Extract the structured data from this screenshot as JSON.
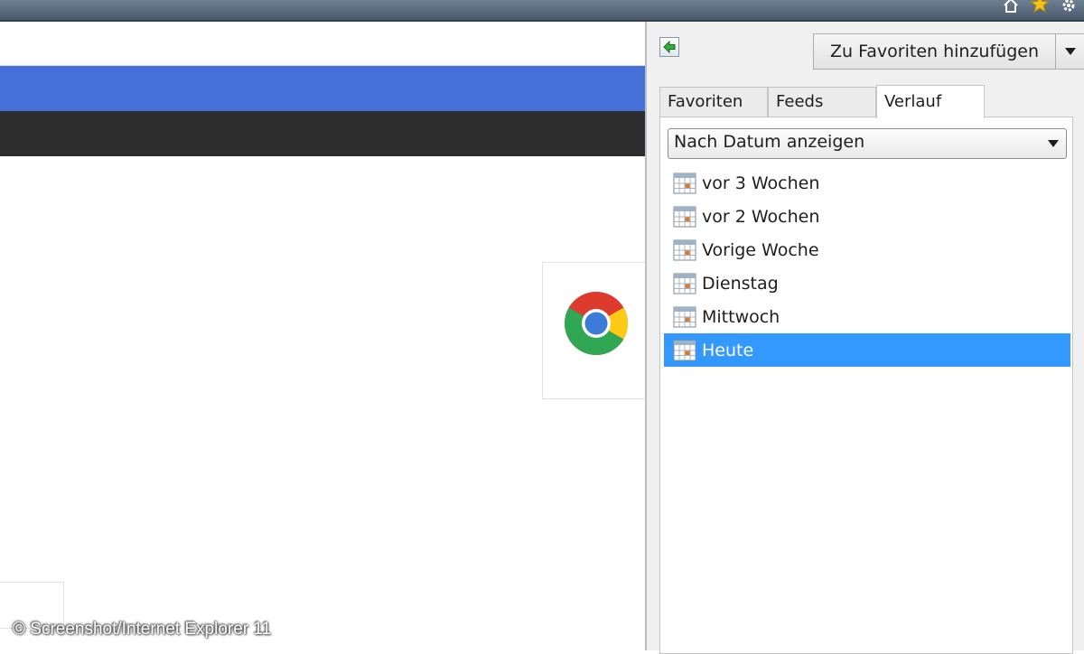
{
  "browser": {
    "toolbar_icons": [
      "home-icon",
      "star-icon",
      "gear-icon"
    ]
  },
  "favorites_panel": {
    "pin_icon": "pin-panel-icon",
    "add_button_label": "Zu Favoriten hinzufügen",
    "tabs": [
      {
        "label": "Favoriten",
        "active": false
      },
      {
        "label": "Feeds",
        "active": false
      },
      {
        "label": "Verlauf",
        "active": true
      }
    ],
    "view_select": {
      "selected": "Nach Datum anzeigen"
    },
    "history_items": [
      {
        "label": "vor 3 Wochen",
        "selected": false
      },
      {
        "label": "vor 2 Wochen",
        "selected": false
      },
      {
        "label": "Vorige Woche",
        "selected": false
      },
      {
        "label": "Dienstag",
        "selected": false
      },
      {
        "label": "Mittwoch",
        "selected": false
      },
      {
        "label": "Heute",
        "selected": true
      }
    ]
  },
  "page": {
    "bar_colors": {
      "blue": "#4470d8",
      "dark": "#2d2d2d"
    },
    "tile_icon": "chrome-logo-icon"
  },
  "watermark": "© Screenshot/Internet Explorer 11",
  "colors": {
    "selection": "#3399ff"
  }
}
